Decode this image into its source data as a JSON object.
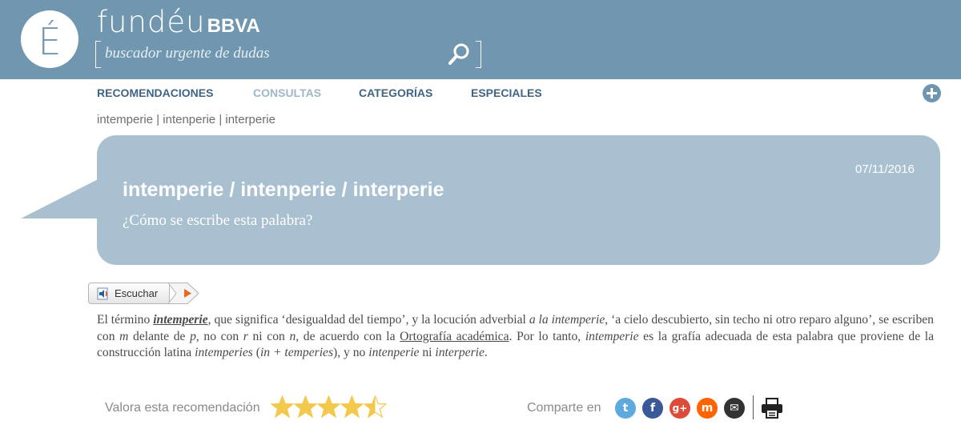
{
  "header": {
    "logo_glyph": "É",
    "brand_main": "fundéu",
    "brand_sub": "BBVA",
    "search_placeholder": "buscador urgente de dudas",
    "accent_color": "#7197b0"
  },
  "nav": {
    "items": [
      {
        "label": "RECOMENDACIONES",
        "active": false
      },
      {
        "label": "CONSULTAS",
        "active": true
      },
      {
        "label": "CATEGORÍAS",
        "active": false
      },
      {
        "label": "ESPECIALES",
        "active": false
      }
    ]
  },
  "breadcrumb": "intemperie | intenperie | interperie",
  "question": {
    "date": "07/11/2016",
    "title": "intemperie / intenperie / interperie",
    "subtitle": "¿Cómo se escribe esta palabra?",
    "bubble_color": "#a9c0d0"
  },
  "listen": {
    "label": "Escuchar"
  },
  "article": {
    "p1": "El término ",
    "term": "intemperie",
    "p2": ", que significa ‘desigualdad del tiempo’, y la locución adverbial ",
    "locucion": "a la intemperie",
    "p3": ", ‘a cielo descubierto, sin techo ni otro reparo alguno’, se escriben con ",
    "m": "m",
    "p4": " delante de ",
    "p": "p",
    "p5": ", no con ",
    "r": "r",
    "p6": " ni con ",
    "n": "n",
    "p7": ", de acuerdo con la ",
    "ortografia_link": "Ortografía académica",
    "p8": ". Por lo tanto, ",
    "term2": "intemperie",
    "p9": " es la grafía adecuada de esta palabra que proviene de la construcción latina ",
    "latin": "intemperies",
    "p10": " (",
    "latin_parts": "in + temperies",
    "p11": "), y no ",
    "wrong1": "intenperie",
    "p12": " ni ",
    "wrong2": "interperie",
    "p13": "."
  },
  "footer": {
    "rate_label": "Valora esta recomendación",
    "rating": 4.5,
    "rating_max": 5,
    "star_color": "#f2c94c",
    "share_label": "Comparte en",
    "share_icons": [
      {
        "name": "twitter-icon",
        "color": "#5ea9dd",
        "glyph": "t"
      },
      {
        "name": "facebook-icon",
        "color": "#3b5998",
        "glyph": "f"
      },
      {
        "name": "google-plus-icon",
        "color": "#dd4b39",
        "glyph": "g+"
      },
      {
        "name": "meneame-icon",
        "color": "#ff6400",
        "glyph": "m"
      },
      {
        "name": "email-icon",
        "color": "#333333",
        "glyph": "✉"
      }
    ]
  }
}
